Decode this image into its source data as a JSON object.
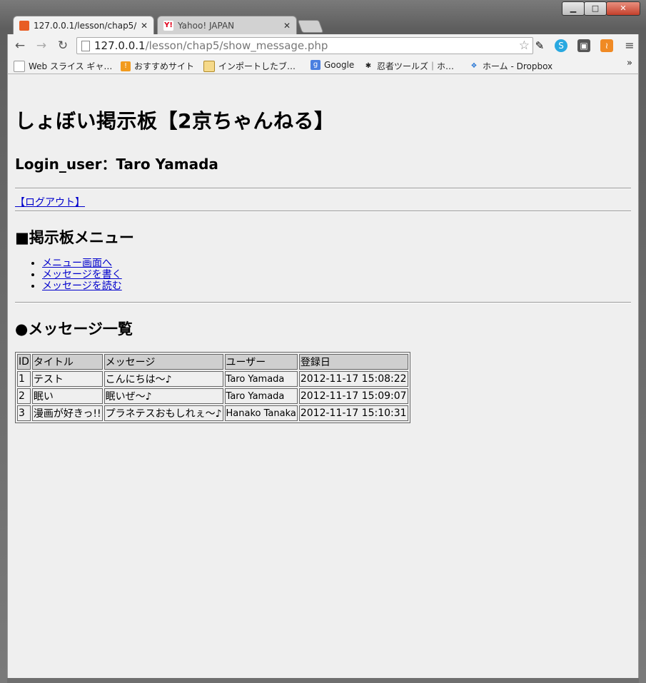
{
  "browser": {
    "tabs": [
      {
        "title": "127.0.0.1/lesson/chap5/",
        "favicon_color": "#e85d24"
      },
      {
        "title": "Yahoo! JAPAN",
        "favicon_color": "#e0001a"
      }
    ],
    "address": {
      "host": "127.0.0.1",
      "path": "/lesson/chap5/show_message.php"
    },
    "bookmarks": [
      {
        "label": "Web スライス ギャ…",
        "icon": "page-icon"
      },
      {
        "label": "おすすめサイト",
        "icon": "bookmark-icon"
      },
      {
        "label": "インポートしたブ…",
        "icon": "folder-icon"
      },
      {
        "label": "Google",
        "icon": "google-icon"
      },
      {
        "label": "忍者ツールズ｜ホ…",
        "icon": "ninja-icon"
      },
      {
        "label": "ホーム - Dropbox",
        "icon": "dropbox-icon"
      }
    ],
    "bookmarks_more": "»"
  },
  "page": {
    "title": "しょぼい掲示板【2京ちゃんねる】",
    "login_user": "Login_user：Taro Yamada",
    "logout_link": "【ログアウト】",
    "menu_title": "■掲示板メニュー",
    "menu_items": [
      "メニュー画面へ",
      "メッセージを書く",
      "メッセージを読む"
    ],
    "list_title": "●メッセージ一覧",
    "table": {
      "headers": [
        "ID",
        "タイトル",
        "メッセージ",
        "ユーザー",
        "登録日"
      ],
      "rows": [
        [
          "1",
          "テスト",
          "こんにちは～♪",
          "Taro Yamada",
          "2012-11-17 15:08:22"
        ],
        [
          "2",
          "眠い",
          "眠いぜ～♪",
          "Taro Yamada",
          "2012-11-17 15:09:07"
        ],
        [
          "3",
          "漫画が好きっ!!",
          "プラネテスおもしれぇ～♪",
          "Hanako Tanaka",
          "2012-11-17 15:10:31"
        ]
      ]
    }
  }
}
